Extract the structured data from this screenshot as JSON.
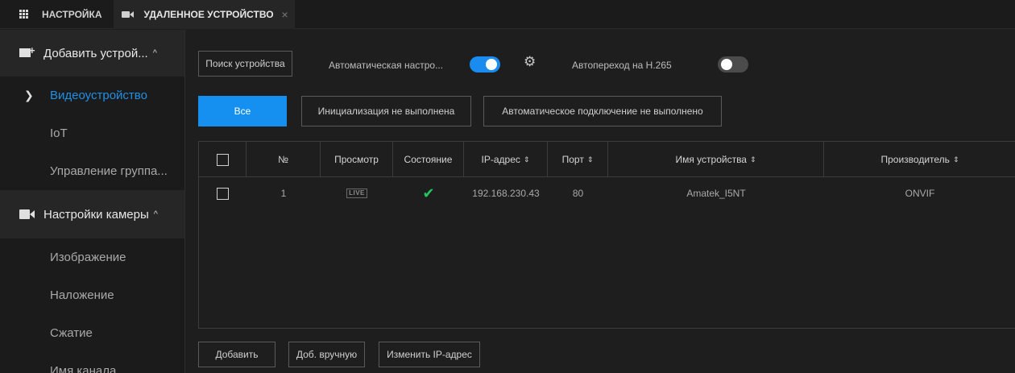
{
  "topbar": {
    "settings_label": "НАСТРОЙКА",
    "remote_tab_label": "УДАЛЕННОЕ УСТРОЙСТВО",
    "close_glyph": "×"
  },
  "sidebar": {
    "group_add": {
      "label": "Добавить устрой...",
      "caret": "^"
    },
    "items_add": [
      {
        "label": "Видеоустройство",
        "active": true
      },
      {
        "label": "IoT"
      },
      {
        "label": "Управление группа..."
      }
    ],
    "group_camera": {
      "label": "Настройки камеры",
      "caret": "^"
    },
    "items_camera": [
      {
        "label": "Изображение"
      },
      {
        "label": "Наложение"
      },
      {
        "label": "Сжатие"
      },
      {
        "label": "Имя канала"
      }
    ]
  },
  "toolbar": {
    "search_button": "Поиск устройства",
    "auto_config_label": "Автоматическая настро...",
    "auto_config_on": true,
    "auto_h265_label": "Автопереход на H.265",
    "auto_h265_on": false
  },
  "filters": {
    "all": "Все",
    "not_initialized": "Инициализация не выполнена",
    "auto_connect_failed": "Автоматическое подключение не выполнено"
  },
  "table": {
    "headers": {
      "num": "№",
      "view": "Просмотр",
      "state": "Состояние",
      "ip": "IP-адрес",
      "port": "Порт",
      "name": "Имя устройства",
      "vendor": "Производитель"
    },
    "sort_glyph": "⇕",
    "rows": [
      {
        "num": "1",
        "view": "LIVE",
        "state_icon": "check-icon",
        "ip": "192.168.230.43",
        "port": "80",
        "name": "Amatek_I5NT",
        "vendor": "ONVIF"
      }
    ]
  },
  "footer": {
    "add": "Добавить",
    "add_manual": "Доб. вручную",
    "change_ip": "Изменить IP-адрес"
  },
  "colors": {
    "accent": "#1690f0",
    "ok": "#22c55e",
    "active_text": "#1e90e8"
  }
}
